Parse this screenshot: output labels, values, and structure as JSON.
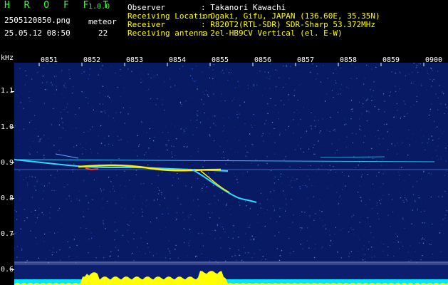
{
  "header": {
    "app_name": "H R O F F T",
    "version": "1.0.0",
    "filename": "2505120850.png",
    "timestamp": "25.05.12 08:50",
    "meteor_label": "meteor",
    "meteor_count": "22",
    "info": [
      {
        "label": "Observer",
        "value": ": Takanori Kawachi"
      },
      {
        "label": "Receiving Location",
        "value": ": Ogaki, Gifu, JAPAN (136.60E, 35.35N)"
      },
      {
        "label": "Receiver",
        "value": ": R820T2(RTL-SDR) SDR-Sharp 53.372MHz"
      },
      {
        "label": "Receiving antenna",
        "value": ": 2el-HB9CV Vertical (el. E-W)"
      }
    ]
  },
  "axes": {
    "y_unit": "kHz",
    "y_ticks": [
      "1.1",
      "1.0",
      "0.9",
      "0.8",
      "0.7",
      "0.6"
    ],
    "x_ticks": [
      "0851",
      "0852",
      "0853",
      "0854",
      "0855",
      "0856",
      "0857",
      "0858",
      "0859",
      "0900"
    ]
  },
  "colors": {
    "background": "#000000",
    "spectrogram": "#071a63",
    "text_green": "#39ff3a",
    "text_yellow": "#ffff00",
    "trace_cyan": "#33d6ff",
    "trace_yellow": "#ffee00",
    "trace_red": "#ff3b3b",
    "strip_fill": "#ffff00",
    "strip_base": "#00e5ff"
  }
}
